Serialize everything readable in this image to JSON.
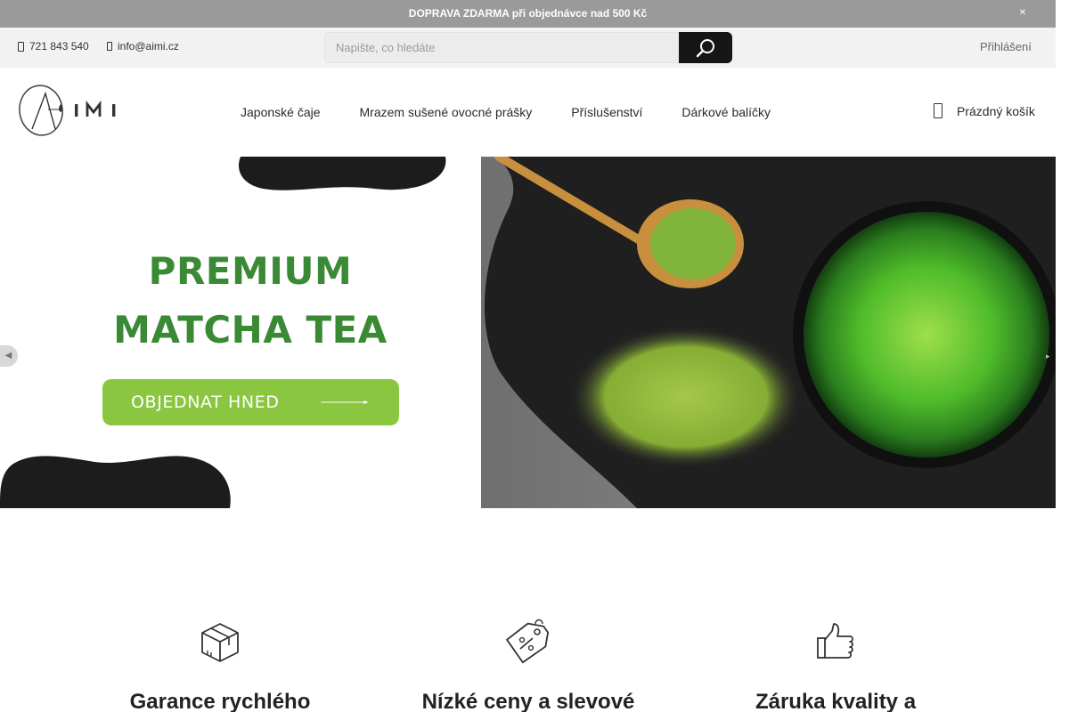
{
  "announcement": {
    "text": "DOPRAVA ZDARMA při objednávce nad 500 Kč",
    "close_icon": "close-icon"
  },
  "contact": {
    "phone": "721 843 540",
    "email": "info@aimi.cz"
  },
  "search": {
    "placeholder": "Napište, co hledáte",
    "value": "",
    "button_icon": "search-icon"
  },
  "account": {
    "login_label": "Přihlášení"
  },
  "logo": {
    "text": "AIMI"
  },
  "nav": {
    "items": [
      {
        "label": "Japonské čaje"
      },
      {
        "label": "Mrazem sušené ovocné prášky"
      },
      {
        "label": "Příslušenství"
      },
      {
        "label": "Dárkové balíčky"
      }
    ]
  },
  "cart": {
    "label": "Prázdný košík",
    "icon": "cart-icon"
  },
  "hero": {
    "title_line1": "PREMIUM",
    "title_line2": "MATCHA TEA",
    "cta_label": "OBJEDNAT HNED",
    "prev_icon": "chevron-left-icon",
    "next_icon": "chevron-right-icon"
  },
  "features": [
    {
      "icon": "box-icon",
      "title": "Garance rychlého"
    },
    {
      "icon": "price-tag-icon",
      "title": "Nízké ceny a slevové"
    },
    {
      "icon": "thumbs-up-icon",
      "title": "Záruka kvality a"
    }
  ],
  "colors": {
    "announcement_bg": "#9a9a9a",
    "strip_bg": "#f2f2f2",
    "search_button": "#161616",
    "hero_title": "#3a8a35",
    "cta": "#8ac63f",
    "blob": "#1c1c1c"
  }
}
